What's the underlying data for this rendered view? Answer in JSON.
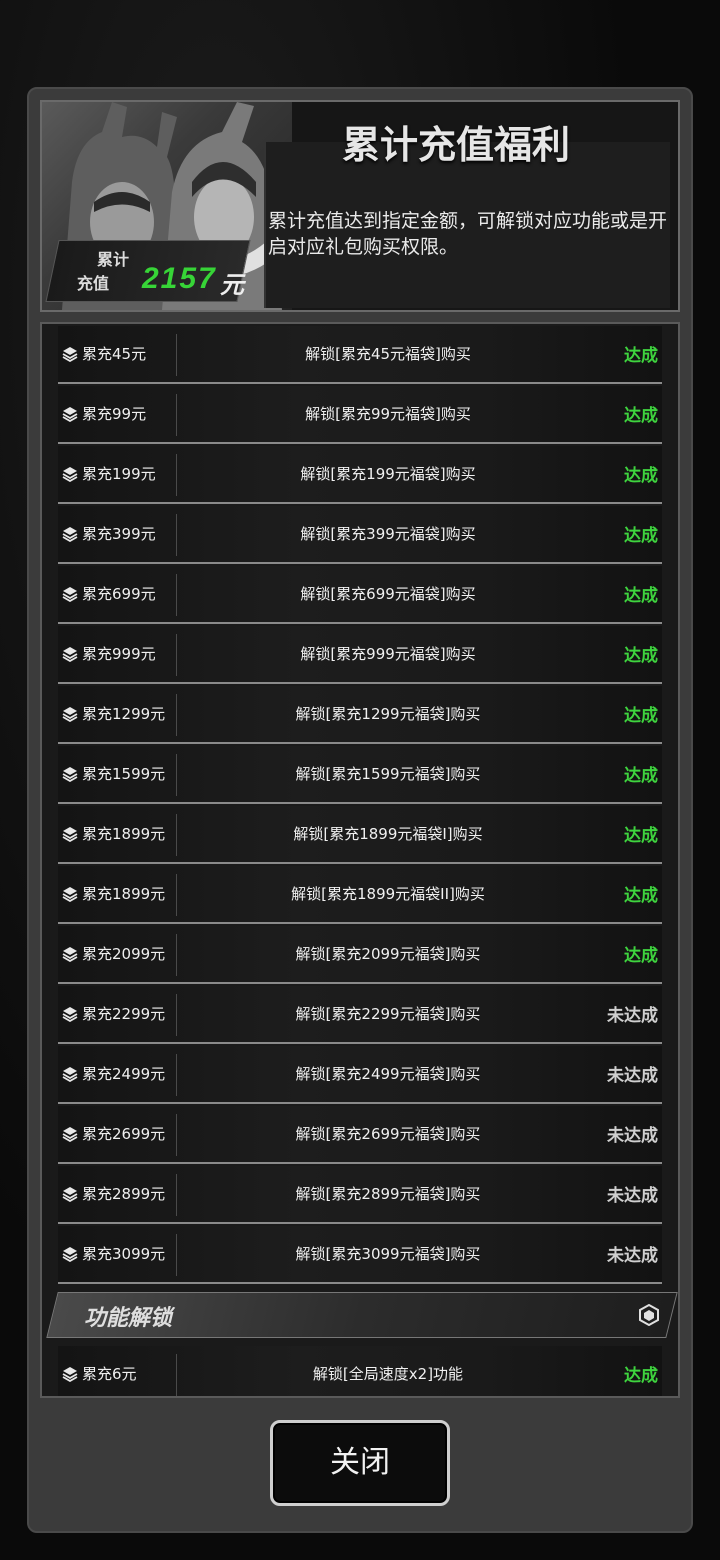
{
  "header": {
    "title": "累计充值福利",
    "description": "累计充值达到指定金额，可解锁对应功能或是开启对应礼包购买权限。",
    "total_label_1": "累计",
    "total_label_2": "充值",
    "total_amount": "2157",
    "total_unit": "元"
  },
  "rows": [
    {
      "condition": "累充45元",
      "reward": "解锁[累充45元福袋]购买",
      "status": "达成",
      "done": true
    },
    {
      "condition": "累充99元",
      "reward": "解锁[累充99元福袋]购买",
      "status": "达成",
      "done": true
    },
    {
      "condition": "累充199元",
      "reward": "解锁[累充199元福袋]购买",
      "status": "达成",
      "done": true
    },
    {
      "condition": "累充399元",
      "reward": "解锁[累充399元福袋]购买",
      "status": "达成",
      "done": true
    },
    {
      "condition": "累充699元",
      "reward": "解锁[累充699元福袋]购买",
      "status": "达成",
      "done": true
    },
    {
      "condition": "累充999元",
      "reward": "解锁[累充999元福袋]购买",
      "status": "达成",
      "done": true
    },
    {
      "condition": "累充1299元",
      "reward": "解锁[累充1299元福袋]购买",
      "status": "达成",
      "done": true
    },
    {
      "condition": "累充1599元",
      "reward": "解锁[累充1599元福袋]购买",
      "status": "达成",
      "done": true
    },
    {
      "condition": "累充1899元",
      "reward": "解锁[累充1899元福袋I]购买",
      "status": "达成",
      "done": true
    },
    {
      "condition": "累充1899元",
      "reward": "解锁[累充1899元福袋II]购买",
      "status": "达成",
      "done": true
    },
    {
      "condition": "累充2099元",
      "reward": "解锁[累充2099元福袋]购买",
      "status": "达成",
      "done": true
    },
    {
      "condition": "累充2299元",
      "reward": "解锁[累充2299元福袋]购买",
      "status": "未达成",
      "done": false
    },
    {
      "condition": "累充2499元",
      "reward": "解锁[累充2499元福袋]购买",
      "status": "未达成",
      "done": false
    },
    {
      "condition": "累充2699元",
      "reward": "解锁[累充2699元福袋]购买",
      "status": "未达成",
      "done": false
    },
    {
      "condition": "累充2899元",
      "reward": "解锁[累充2899元福袋]购买",
      "status": "未达成",
      "done": false
    },
    {
      "condition": "累充3099元",
      "reward": "解锁[累充3099元福袋]购买",
      "status": "未达成",
      "done": false
    }
  ],
  "section": {
    "title": "功能解锁",
    "icon": "hexagon-icon"
  },
  "feature_rows": [
    {
      "condition": "累充6元",
      "reward": "解锁[全局速度x2]功能",
      "status": "达成",
      "done": true
    }
  ],
  "colors": {
    "done": "#3ed33e",
    "not_done": "#cfcfcf",
    "total_amount": "#37d437"
  },
  "close_button": {
    "label": "关闭"
  }
}
